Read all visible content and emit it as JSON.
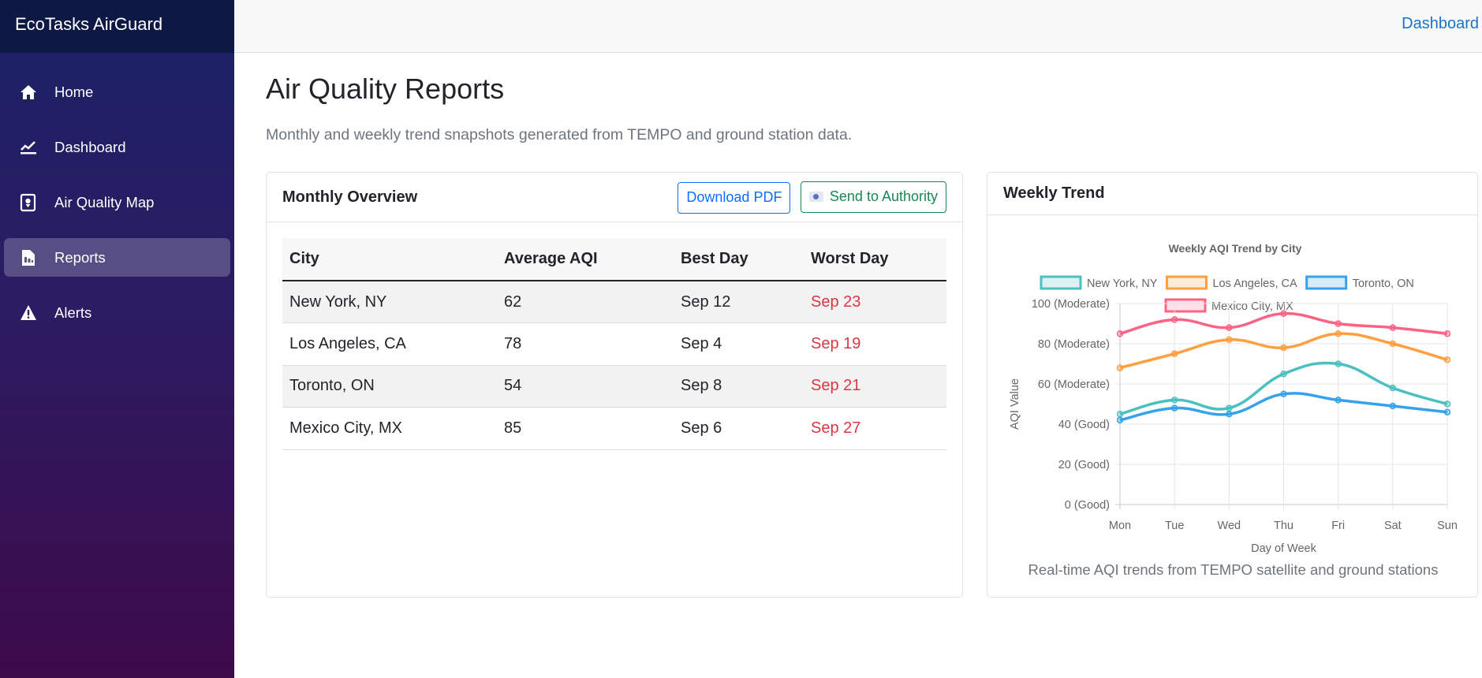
{
  "app": {
    "brand": "EcoTasks AirGuard"
  },
  "sidebar": {
    "items": [
      {
        "label": "Home",
        "icon": "home-icon"
      },
      {
        "label": "Dashboard",
        "icon": "chart-line-icon"
      },
      {
        "label": "Air Quality Map",
        "icon": "map-icon"
      },
      {
        "label": "Reports",
        "icon": "report-icon",
        "active": true
      },
      {
        "label": "Alerts",
        "icon": "alert-icon"
      }
    ]
  },
  "topbar": {
    "link": "Dashboard"
  },
  "page": {
    "title": "Air Quality Reports",
    "subtitle": "Monthly and weekly trend snapshots generated from TEMPO and ground station data."
  },
  "monthly": {
    "title": "Monthly Overview",
    "download_label": "Download PDF",
    "send_label": "Send to Authority",
    "columns": [
      "City",
      "Average AQI",
      "Best Day",
      "Worst Day"
    ],
    "rows": [
      {
        "city": "New York, NY",
        "avg": "62",
        "best": "Sep 12",
        "worst": "Sep 23"
      },
      {
        "city": "Los Angeles, CA",
        "avg": "78",
        "best": "Sep 4",
        "worst": "Sep 19"
      },
      {
        "city": "Toronto, ON",
        "avg": "54",
        "best": "Sep 8",
        "worst": "Sep 21"
      },
      {
        "city": "Mexico City, MX",
        "avg": "85",
        "best": "Sep 6",
        "worst": "Sep 27"
      }
    ]
  },
  "weekly": {
    "title": "Weekly Trend",
    "caption": "Real-time AQI trends from TEMPO satellite and ground stations"
  },
  "colors": {
    "accent": "#0d6efd",
    "success": "#198754",
    "danger": "#dc3545"
  },
  "chart_data": {
    "type": "line",
    "title": "Weekly AQI Trend by City",
    "xlabel": "Day of Week",
    "ylabel": "AQI Value",
    "categories": [
      "Mon",
      "Tue",
      "Wed",
      "Thu",
      "Fri",
      "Sat",
      "Sun"
    ],
    "ylim": [
      0,
      100
    ],
    "yticks": [
      {
        "value": 0,
        "label": "0 (Good)"
      },
      {
        "value": 20,
        "label": "20 (Good)"
      },
      {
        "value": 40,
        "label": "40 (Good)"
      },
      {
        "value": 60,
        "label": "60 (Moderate)"
      },
      {
        "value": 80,
        "label": "80 (Moderate)"
      },
      {
        "value": 100,
        "label": "100 (Moderate)"
      }
    ],
    "grid": true,
    "legend": "top",
    "series": [
      {
        "name": "New York, NY",
        "color": "#4bc0c0",
        "values": [
          45,
          52,
          48,
          65,
          70,
          58,
          50
        ]
      },
      {
        "name": "Los Angeles, CA",
        "color": "#ff9f40",
        "values": [
          68,
          75,
          82,
          78,
          85,
          80,
          72
        ]
      },
      {
        "name": "Toronto, ON",
        "color": "#36a2eb",
        "values": [
          42,
          48,
          45,
          55,
          52,
          49,
          46
        ]
      },
      {
        "name": "Mexico City, MX",
        "color": "#ff6384",
        "values": [
          85,
          92,
          88,
          95,
          90,
          88,
          85
        ]
      }
    ]
  }
}
